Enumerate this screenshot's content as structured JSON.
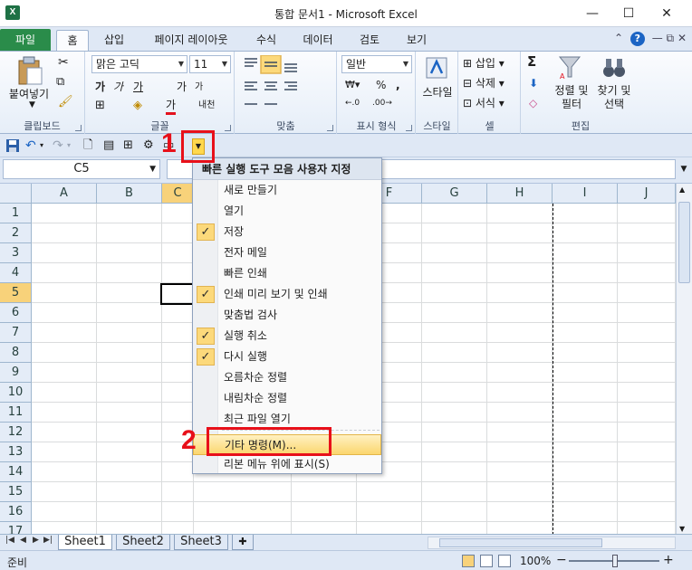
{
  "window": {
    "title": "통합 문서1 - Microsoft Excel",
    "minimize": "—",
    "maximize": "☐",
    "close": "✕"
  },
  "ribbon_tabs": {
    "file": "파일",
    "items": [
      "홈",
      "삽입",
      "페이지 레이아웃",
      "수식",
      "데이터",
      "검토",
      "보기"
    ],
    "active": "홈"
  },
  "ribbon": {
    "clipboard": {
      "label": "클립보드",
      "paste": "붙여넣기"
    },
    "font": {
      "label": "글꼴",
      "font_name": "맑은 고딕",
      "font_size": "11",
      "bold": "가",
      "italic": "가",
      "underline": "가",
      "grow": "가",
      "shrink": "가",
      "color": "가",
      "phonetic": "내천"
    },
    "alignment": {
      "label": "맞춤"
    },
    "number": {
      "label": "표시 형식",
      "format": "일반",
      "percent": "%"
    },
    "styles": {
      "label": "스타일",
      "button": "스타일"
    },
    "cells": {
      "label": "셀",
      "insert": "삽입",
      "delete": "삭제",
      "format": "서식"
    },
    "editing": {
      "label": "편집",
      "sort_filter_1": "정렬 및",
      "sort_filter_2": "필터",
      "find_select_1": "찾기 및",
      "find_select_2": "선택",
      "sum": "Σ"
    }
  },
  "formula_bar": {
    "name_box": "C5",
    "formula": ""
  },
  "grid": {
    "columns": [
      "A",
      "B",
      "C",
      "D",
      "E",
      "F",
      "G",
      "H",
      "I",
      "J"
    ],
    "rows": [
      "1",
      "2",
      "3",
      "4",
      "5",
      "6",
      "7",
      "8",
      "9",
      "10",
      "11",
      "12",
      "13",
      "14",
      "15",
      "16",
      "17"
    ],
    "selected_column": "C",
    "selected_row": "5"
  },
  "qat_menu": {
    "header": "빠른 실행 도구 모음 사용자 지정",
    "items": [
      {
        "label": "새로 만들기",
        "checked": false
      },
      {
        "label": "열기",
        "checked": false
      },
      {
        "label": "저장",
        "checked": true
      },
      {
        "label": "전자 메일",
        "checked": false
      },
      {
        "label": "빠른 인쇄",
        "checked": false
      },
      {
        "label": "인쇄 미리 보기 및 인쇄",
        "checked": true
      },
      {
        "label": "맞춤법 검사",
        "checked": false
      },
      {
        "label": "실행 취소",
        "checked": true
      },
      {
        "label": "다시 실행",
        "checked": true
      },
      {
        "label": "오름차순 정렬",
        "checked": false
      },
      {
        "label": "내림차순 정렬",
        "checked": false
      },
      {
        "label": "최근 파일 열기",
        "checked": false
      }
    ],
    "more_commands": "기타 명령(M)...",
    "show_below": "리본 메뉴 위에 표시(S)",
    "check_mark": "✓"
  },
  "sheets": {
    "tabs": [
      "Sheet1",
      "Sheet2",
      "Sheet3"
    ],
    "active": "Sheet1"
  },
  "status": {
    "ready": "준비",
    "zoom": "100%",
    "zoom_minus": "−",
    "zoom_plus": "+"
  },
  "annotations": {
    "step1": "1",
    "step2": "2",
    "color": "#e8101a"
  }
}
